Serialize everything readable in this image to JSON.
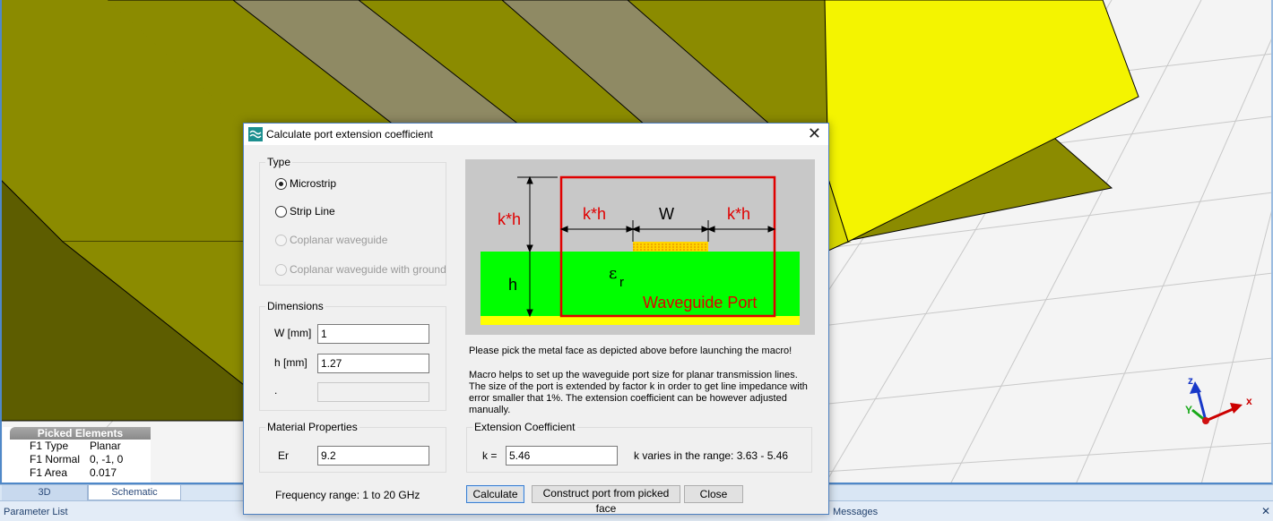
{
  "picked": {
    "header": "Picked Elements",
    "rows": [
      {
        "k": "F1 Type",
        "v": "Planar"
      },
      {
        "k": "F1 Normal",
        "v": "0, -1, 0"
      },
      {
        "k": "F1 Area",
        "v": "0.017"
      }
    ]
  },
  "tabs": {
    "t3d": "3D",
    "schematic": "Schematic"
  },
  "bottom": {
    "param": "Parameter List",
    "messages": "Messages",
    "close": "✕"
  },
  "axes": {
    "x": "x",
    "y": "Y",
    "z": "z"
  },
  "dialog": {
    "title": "Calculate port extension coefficient",
    "close": "✕",
    "type": {
      "legend": "Type",
      "options": [
        {
          "label": "Microstrip",
          "selected": true,
          "enabled": true
        },
        {
          "label": "Strip Line",
          "selected": false,
          "enabled": true
        },
        {
          "label": "Coplanar waveguide",
          "selected": false,
          "enabled": false
        },
        {
          "label": "Coplanar waveguide with ground",
          "selected": false,
          "enabled": false
        }
      ]
    },
    "dimensions": {
      "legend": "Dimensions",
      "w_label": "W [mm]",
      "w_value": "1",
      "h_label": "h [mm]",
      "h_value": "1.27",
      "extra_label": ".",
      "extra_value": ""
    },
    "material": {
      "legend": "Material Properties",
      "er_label": "Er",
      "er_value": "9.2"
    },
    "frequency": "Frequency range: 1 to 20 GHz",
    "diagram": {
      "kh_left": "k*h",
      "kh_mid": "k*h",
      "kh_right": "k*h",
      "w": "W",
      "h": "h",
      "eps": "ε",
      "eps_sub": "r",
      "port_label": "Waveguide Port"
    },
    "note1": "Please pick the metal face as depicted above before launching the macro!",
    "note2": "Macro helps to set up the waveguide port size for planar transmission lines. The size of the port is extended by factor k in order to get line impedance with error smaller that 1%. The extension coefficient can be however adjusted manually.",
    "extension": {
      "legend": "Extension Coefficient",
      "k_label": "k =",
      "k_value": "5.46",
      "range": "k varies in the range: 3.63 - 5.46"
    },
    "buttons": {
      "calculate": "Calculate",
      "construct": "Construct port from picked face",
      "close": "Close"
    }
  },
  "colors": {
    "substrate": "#00ff00",
    "ground": "#ffff00",
    "port": "#e00000",
    "trace": "#ffd500",
    "model_olive": "#8b8b00",
    "model_yellow": "#f4f400"
  }
}
